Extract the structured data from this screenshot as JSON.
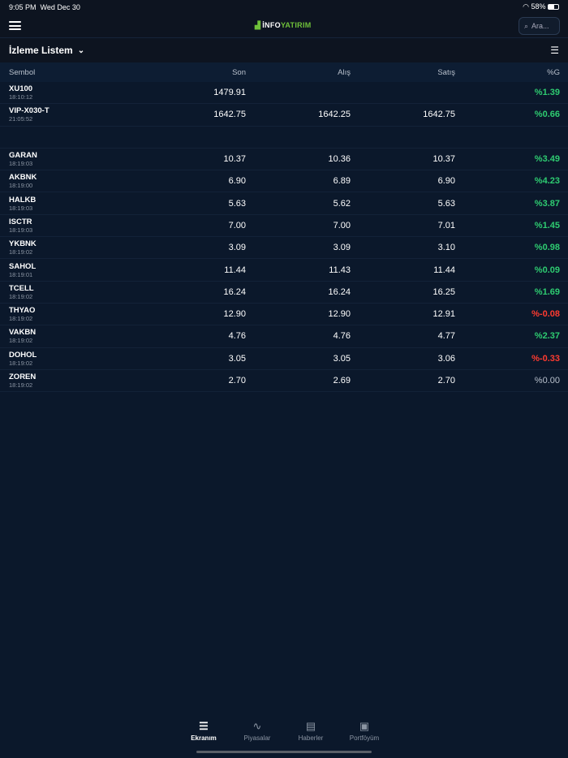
{
  "status": {
    "time": "9:05 PM",
    "date": "Wed Dec 30",
    "battery": "58%"
  },
  "header": {
    "logo_a": "İNFO",
    "logo_b": "YATIRIM",
    "search_placeholder": "Ara..."
  },
  "watchlist": {
    "title": "İzleme Listem"
  },
  "columns": [
    "Sembol",
    "Son",
    "Alış",
    "Satış",
    "%G"
  ],
  "rows": [
    {
      "symbol": "XU100",
      "time": "18:10:12",
      "son": "1479.91",
      "alis": "",
      "satis": "",
      "pct": "%1.39",
      "dir": "up"
    },
    {
      "symbol": "VIP-X030-T",
      "time": "21:05:52",
      "son": "1642.75",
      "alis": "1642.25",
      "satis": "1642.75",
      "pct": "%0.66",
      "dir": "up"
    },
    null,
    {
      "symbol": "GARAN",
      "time": "18:19:03",
      "son": "10.37",
      "alis": "10.36",
      "satis": "10.37",
      "pct": "%3.49",
      "dir": "up"
    },
    {
      "symbol": "AKBNK",
      "time": "18:19:00",
      "son": "6.90",
      "alis": "6.89",
      "satis": "6.90",
      "pct": "%4.23",
      "dir": "up"
    },
    {
      "symbol": "HALKB",
      "time": "18:19:03",
      "son": "5.63",
      "alis": "5.62",
      "satis": "5.63",
      "pct": "%3.87",
      "dir": "up"
    },
    {
      "symbol": "ISCTR",
      "time": "18:19:03",
      "son": "7.00",
      "alis": "7.00",
      "satis": "7.01",
      "pct": "%1.45",
      "dir": "up"
    },
    {
      "symbol": "YKBNK",
      "time": "18:19:02",
      "son": "3.09",
      "alis": "3.09",
      "satis": "3.10",
      "pct": "%0.98",
      "dir": "up"
    },
    {
      "symbol": "SAHOL",
      "time": "18:19:01",
      "son": "11.44",
      "alis": "11.43",
      "satis": "11.44",
      "pct": "%0.09",
      "dir": "up"
    },
    {
      "symbol": "TCELL",
      "time": "18:19:02",
      "son": "16.24",
      "alis": "16.24",
      "satis": "16.25",
      "pct": "%1.69",
      "dir": "up"
    },
    {
      "symbol": "THYAO",
      "time": "18:19:02",
      "son": "12.90",
      "alis": "12.90",
      "satis": "12.91",
      "pct": "%-0.08",
      "dir": "dn"
    },
    {
      "symbol": "VAKBN",
      "time": "18:19:02",
      "son": "4.76",
      "alis": "4.76",
      "satis": "4.77",
      "pct": "%2.37",
      "dir": "up"
    },
    {
      "symbol": "DOHOL",
      "time": "18:19:02",
      "son": "3.05",
      "alis": "3.05",
      "satis": "3.06",
      "pct": "%-0.33",
      "dir": "dn"
    },
    {
      "symbol": "ZOREN",
      "time": "18:19:02",
      "son": "2.70",
      "alis": "2.69",
      "satis": "2.70",
      "pct": "%0.00",
      "dir": "fl"
    }
  ],
  "tabs": [
    {
      "label": "Ekranım",
      "icon": "list-icon",
      "active": true
    },
    {
      "label": "Piyasalar",
      "icon": "pulse-icon"
    },
    {
      "label": "Haberler",
      "icon": "news-icon"
    },
    {
      "label": "Portföyüm",
      "icon": "briefcase-icon"
    }
  ],
  "colors": {
    "up": "#2ecc71",
    "down": "#ff3b30",
    "brand": "#6fc13a"
  }
}
